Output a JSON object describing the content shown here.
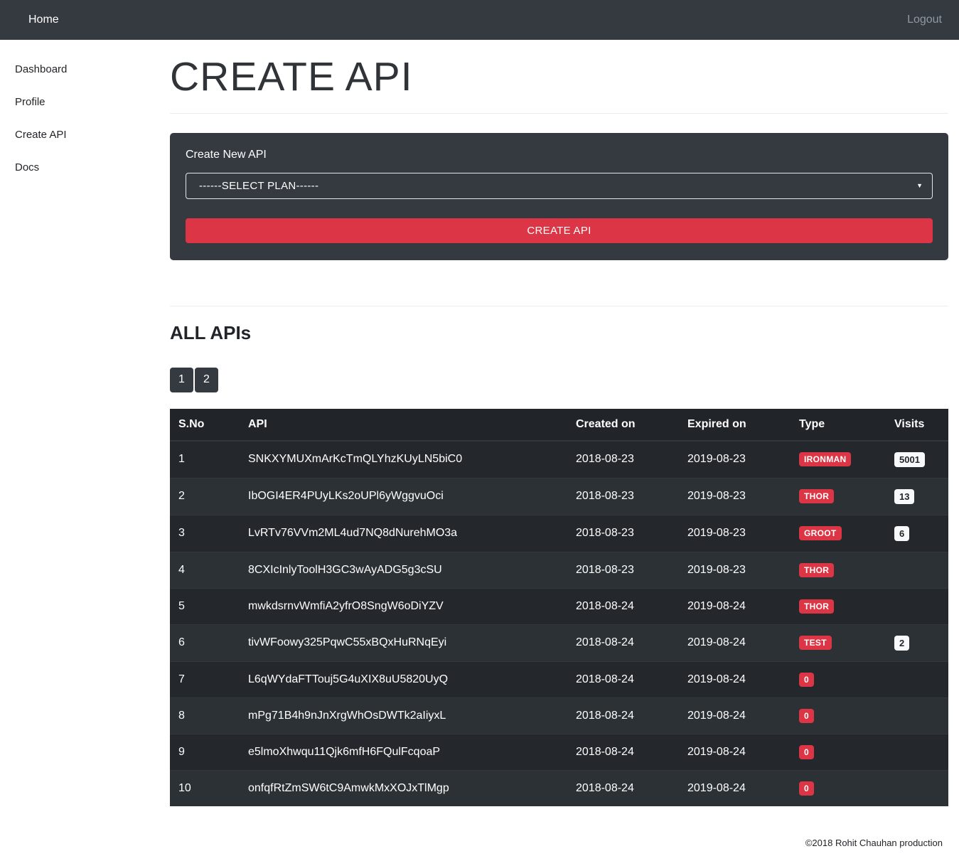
{
  "navbar": {
    "brand": "Home",
    "logout_label": "Logout"
  },
  "sidebar": {
    "items": [
      {
        "label": "Dashboard"
      },
      {
        "label": "Profile"
      },
      {
        "label": "Create API"
      },
      {
        "label": "Docs"
      }
    ]
  },
  "main": {
    "page_title": "CREATE API",
    "create_panel": {
      "label": "Create New API",
      "select_value": "------SELECT PLAN------",
      "button_label": "CREATE API"
    },
    "all_apis_title": "ALL APIs",
    "pagination": [
      "1",
      "2"
    ],
    "table": {
      "headers": [
        "S.No",
        "API",
        "Created on",
        "Expired on",
        "Type",
        "Visits"
      ],
      "rows": [
        {
          "sno": "1",
          "api": "SNKXYMUXmArKcTmQLYhzKUyLN5biC0",
          "created": "2018-08-23",
          "expired": "2019-08-23",
          "type": "IRONMAN",
          "visits": "5001"
        },
        {
          "sno": "2",
          "api": "IbOGI4ER4PUyLKs2oUPl6yWggvuOci",
          "created": "2018-08-23",
          "expired": "2019-08-23",
          "type": "THOR",
          "visits": "13"
        },
        {
          "sno": "3",
          "api": "LvRTv76VVm2ML4ud7NQ8dNurehMO3a",
          "created": "2018-08-23",
          "expired": "2019-08-23",
          "type": "GROOT",
          "visits": "6"
        },
        {
          "sno": "4",
          "api": "8CXIcInlyToolH3GC3wAyADG5g3cSU",
          "created": "2018-08-23",
          "expired": "2019-08-23",
          "type": "THOR",
          "visits": ""
        },
        {
          "sno": "5",
          "api": "mwkdsrnvWmfiA2yfrO8SngW6oDiYZV",
          "created": "2018-08-24",
          "expired": "2019-08-24",
          "type": "THOR",
          "visits": ""
        },
        {
          "sno": "6",
          "api": "tivWFoowy325PqwC55xBQxHuRNqEyi",
          "created": "2018-08-24",
          "expired": "2019-08-24",
          "type": "TEST",
          "visits": "2"
        },
        {
          "sno": "7",
          "api": "L6qWYdaFTTouj5G4uXIX8uU5820UyQ",
          "created": "2018-08-24",
          "expired": "2019-08-24",
          "type": "0",
          "visits": ""
        },
        {
          "sno": "8",
          "api": "mPg71B4h9nJnXrgWhOsDWTk2aIiyxL",
          "created": "2018-08-24",
          "expired": "2019-08-24",
          "type": "0",
          "visits": ""
        },
        {
          "sno": "9",
          "api": "e5lmoXhwqu11Qjk6mfH6FQulFcqoaP",
          "created": "2018-08-24",
          "expired": "2019-08-24",
          "type": "0",
          "visits": ""
        },
        {
          "sno": "10",
          "api": "onfqfRtZmSW6tC9AmwkMxXOJxTlMgp",
          "created": "2018-08-24",
          "expired": "2019-08-24",
          "type": "0",
          "visits": ""
        }
      ]
    }
  },
  "footer": {
    "copyright": "©2018 Rohit Chauhan production"
  },
  "colors": {
    "navbar_bg": "#343a40",
    "panel_bg": "#343a40",
    "accent_red": "#dc3545",
    "table_header_bg": "#212529",
    "table_row_odd": "#24272b",
    "table_row_even": "#2c3136",
    "badge_light_bg": "#f8f9fa"
  }
}
